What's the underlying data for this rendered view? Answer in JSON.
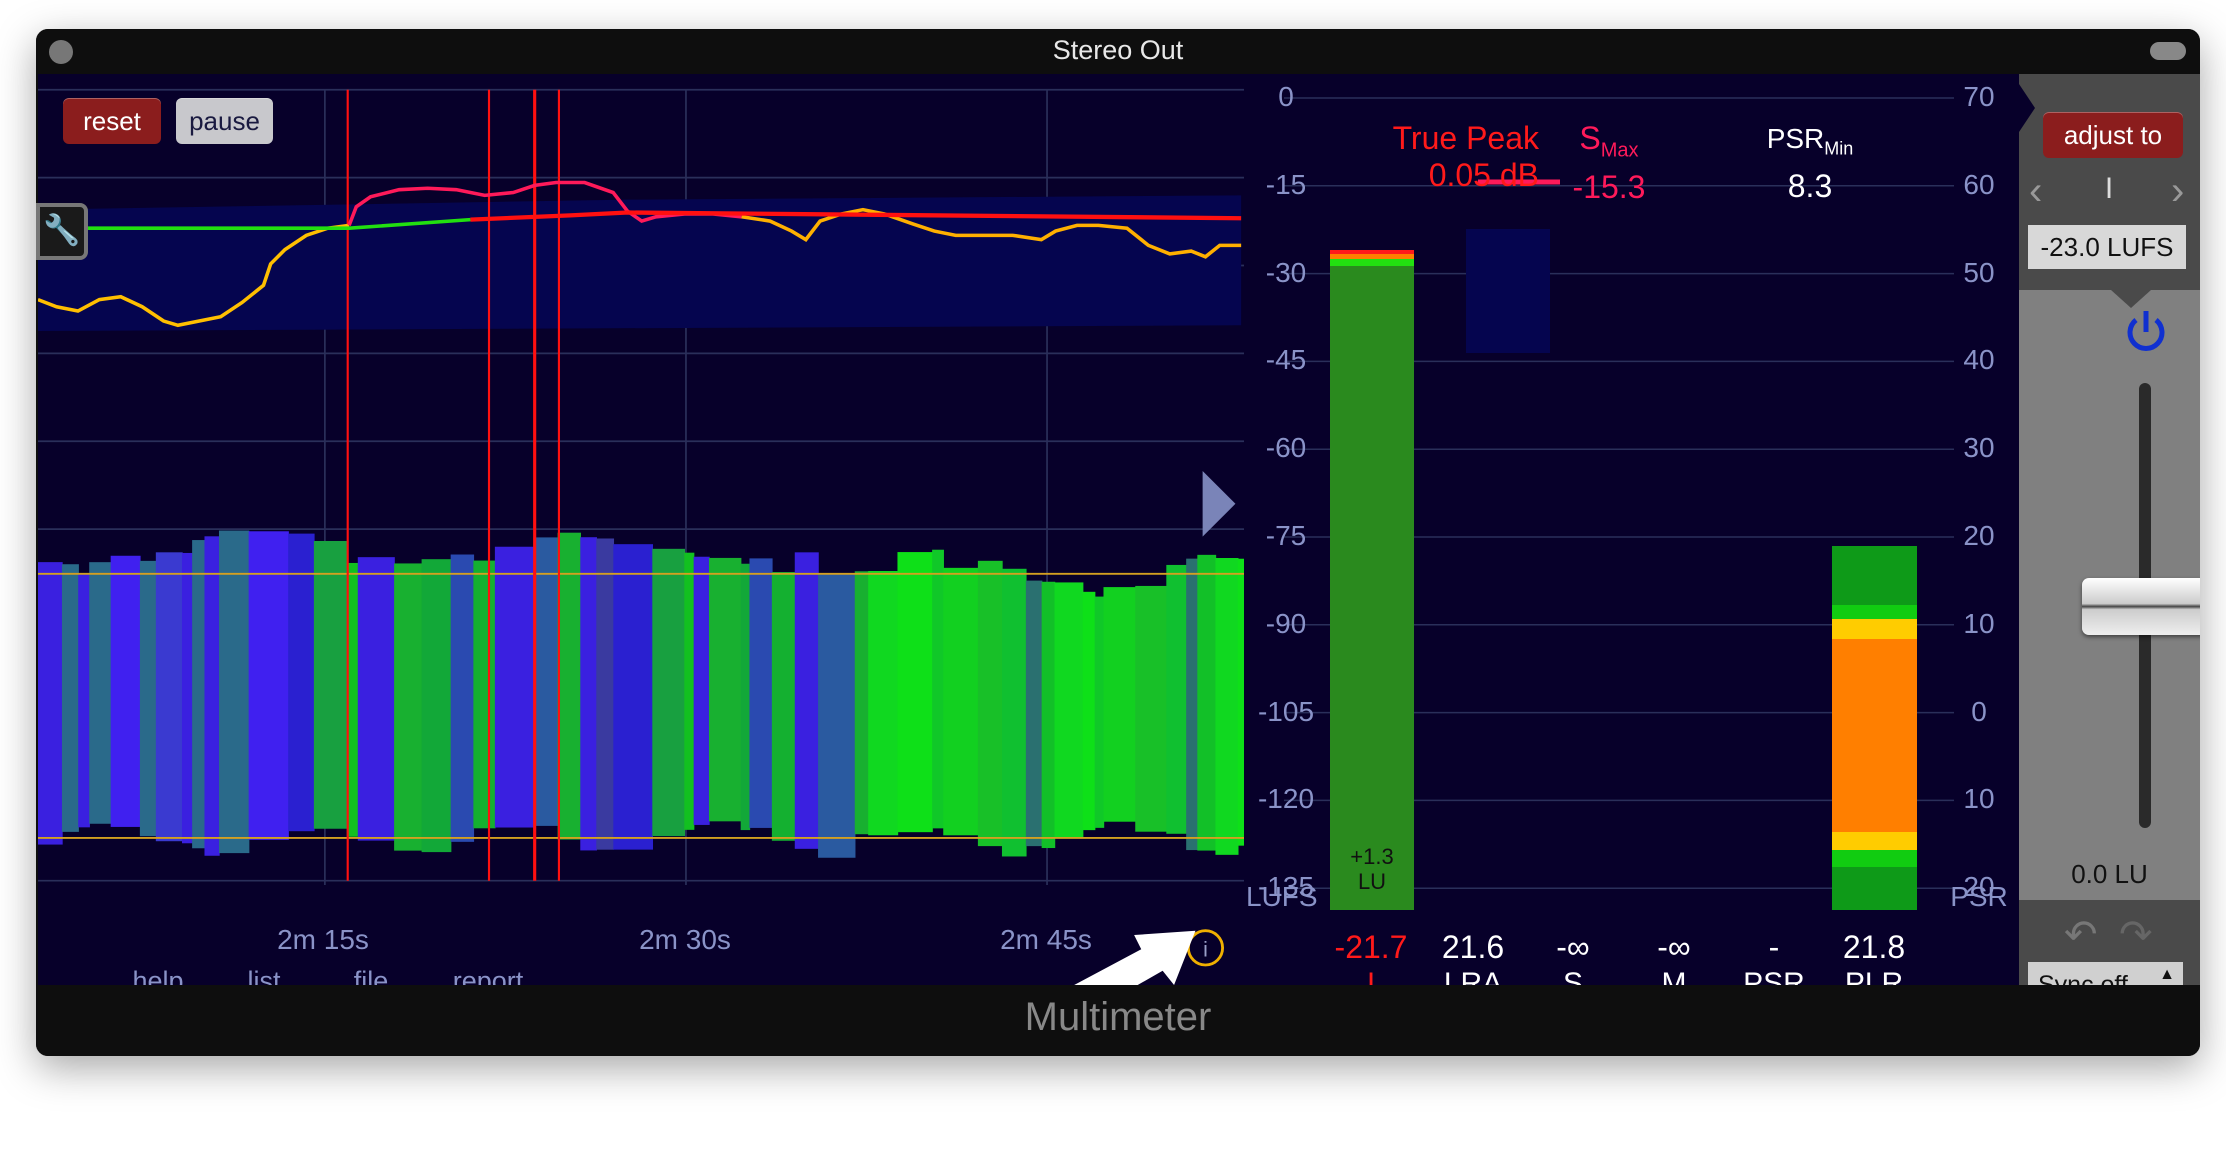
{
  "window": {
    "title": "Stereo Out",
    "plugin_name": "Multimeter"
  },
  "toolbar": {
    "reset_label": "reset",
    "pause_label": "pause"
  },
  "left_axis": {
    "ticks": [
      "0",
      "-15",
      "-30",
      "-45",
      "-60",
      "-75",
      "-90",
      "-105",
      "-120",
      "-135"
    ],
    "unit": "LUFS"
  },
  "right_axis": {
    "ticks": [
      "70",
      "60",
      "50",
      "40",
      "30",
      "20",
      "10",
      "0",
      "10",
      "20"
    ],
    "unit": "PSR"
  },
  "time_axis": {
    "ticks": [
      "2m 15s",
      "2m 30s",
      "2m 45s"
    ]
  },
  "menu": {
    "items": [
      "help",
      "list",
      "file",
      "report"
    ]
  },
  "header": {
    "true_peak_label": "True Peak",
    "true_peak_value": "0.05 dB",
    "smax_label": "S",
    "smax_sub": "Max",
    "smax_value": "-15.3",
    "psrmin_label": "PSR",
    "psrmin_sub": "Min",
    "psrmin_value": "8.3"
  },
  "integrated_bar": {
    "delta": "+1.3",
    "delta_unit": "LU"
  },
  "readouts": [
    {
      "value": "-21.7",
      "label": "I",
      "color": "#ff1a1a"
    },
    {
      "value": "21.6",
      "label": "LRA",
      "color": "#ffffff"
    },
    {
      "value": "-∞",
      "label": "S",
      "color": "#ffffff"
    },
    {
      "value": "-∞",
      "label": "M",
      "color": "#ffffff"
    },
    {
      "value": "-",
      "label": "PSR",
      "color": "#ffffff"
    },
    {
      "value": "21.8",
      "label": "PLR",
      "color": "#ffffff"
    }
  ],
  "right_panel": {
    "adjust_label": "adjust to",
    "preset_marker": "I",
    "target_value": "-23.0 LUFS",
    "gain_value": "0.0 LU",
    "sync_value": "Sync off",
    "gain_slider_lu": 0.0,
    "power_on": true
  },
  "colors": {
    "background": "#07002a",
    "accent_red": "#ff1a1a",
    "smax_pink": "#ff1a5a",
    "bar_green": "#2a8a1e",
    "orange": "#ff7f00"
  }
}
